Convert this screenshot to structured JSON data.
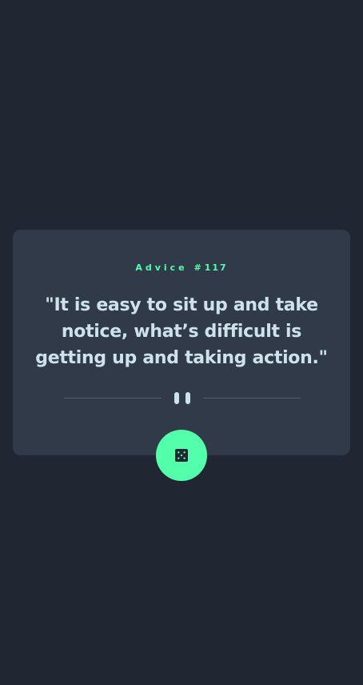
{
  "card": {
    "advice_label": "Advice #",
    "advice_number": "117",
    "quote": "\"It is easy to sit up and take notice, what’s difficult is getting up and taking action.\""
  },
  "icons": {
    "divider": "pause-divider-icon",
    "button": "dice-icon"
  },
  "colors": {
    "background": "#202733",
    "card": "#313a48",
    "accent": "#53ffaa",
    "text": "#cee3e9",
    "divider": "#4f5d74"
  }
}
